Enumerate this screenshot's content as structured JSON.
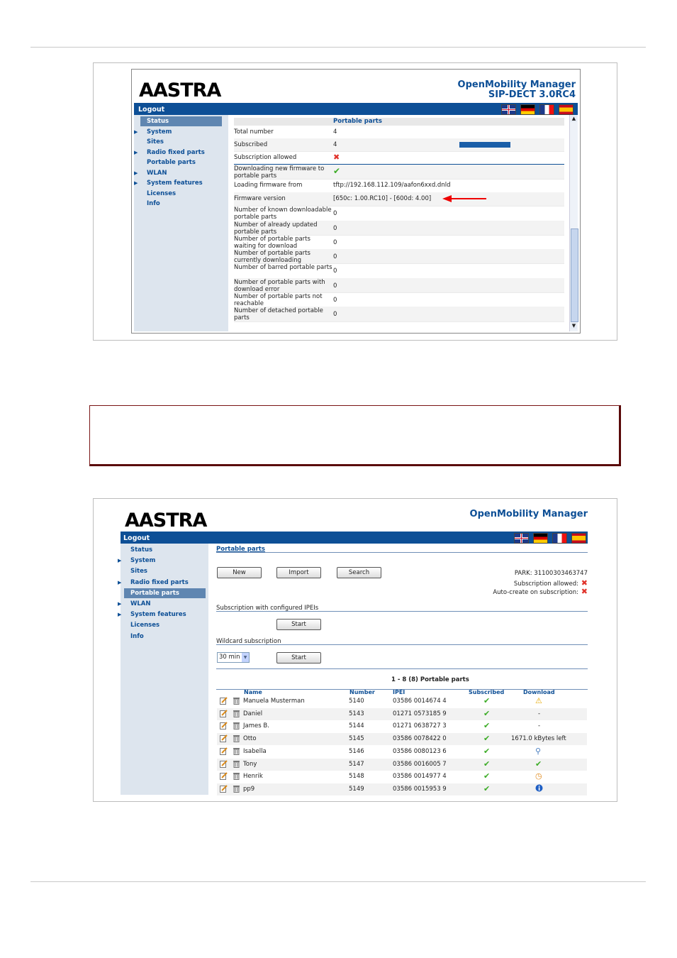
{
  "screen1": {
    "logo": "AASTRA",
    "app_title": "OpenMobility Manager",
    "app_version": "SIP-DECT 3.0RC4",
    "logout": "Logout",
    "nav": [
      {
        "label": "Status",
        "arrow": false,
        "selected": true
      },
      {
        "label": "System",
        "arrow": true,
        "selected": false
      },
      {
        "label": "Sites",
        "arrow": false,
        "selected": false
      },
      {
        "label": "Radio fixed parts",
        "arrow": true,
        "selected": false
      },
      {
        "label": "Portable parts",
        "arrow": false,
        "selected": false
      },
      {
        "label": "WLAN",
        "arrow": true,
        "selected": false
      },
      {
        "label": "System features",
        "arrow": true,
        "selected": false
      },
      {
        "label": "Licenses",
        "arrow": false,
        "selected": false
      },
      {
        "label": "Info",
        "arrow": false,
        "selected": false
      }
    ],
    "section_title": "Portable parts",
    "rows": [
      {
        "label": "Total number",
        "value": "4"
      },
      {
        "label": "Subscribed",
        "value": "4"
      },
      {
        "label": "Subscription allowed",
        "value": "✖"
      },
      {
        "label": "Downloading new firmware to portable parts",
        "value": "✔"
      },
      {
        "label": "Loading firmware from",
        "value": "tftp://192.168.112.109/aafon6xxd.dnld"
      },
      {
        "label": "Firmware version",
        "value": "[650c: 1.00.RC10] - [600d: 4.00]"
      },
      {
        "label": "Number of known downloadable portable parts",
        "value": "0"
      },
      {
        "label": "Number of already updated portable parts",
        "value": "0"
      },
      {
        "label": "Number of portable parts waiting for download",
        "value": "0"
      },
      {
        "label": "Number of portable parts currently downloading",
        "value": "0"
      },
      {
        "label": "Number of barred portable parts",
        "value": "0"
      },
      {
        "label": "Number of portable parts with download error",
        "value": "0"
      },
      {
        "label": "Number of portable parts not reachable",
        "value": "0"
      },
      {
        "label": "Number of detached portable parts",
        "value": "0"
      }
    ],
    "subscribed_fraction": 1.0
  },
  "screen2": {
    "logo": "AASTRA",
    "app_title": "OpenMobility Manager",
    "logout": "Logout",
    "nav": [
      {
        "label": "Status",
        "arrow": false,
        "selected": false
      },
      {
        "label": "System",
        "arrow": true,
        "selected": false
      },
      {
        "label": "Sites",
        "arrow": false,
        "selected": false
      },
      {
        "label": "Radio fixed parts",
        "arrow": true,
        "selected": false
      },
      {
        "label": "Portable parts",
        "arrow": false,
        "selected": true
      },
      {
        "label": "WLAN",
        "arrow": true,
        "selected": false
      },
      {
        "label": "System features",
        "arrow": true,
        "selected": false
      },
      {
        "label": "Licenses",
        "arrow": false,
        "selected": false
      },
      {
        "label": "Info",
        "arrow": false,
        "selected": false
      }
    ],
    "page_title": "Portable parts",
    "buttons": {
      "new": "New",
      "import": "Import",
      "search": "Search",
      "start": "Start"
    },
    "park": "PARK: 31100303463747",
    "subscription_allowed": "Subscription allowed:",
    "auto_create": "Auto-create on subscription:",
    "subscription_configured": "Subscription with configured IPEIs",
    "wildcard": "Wildcard subscription",
    "wildcard_select": "30 min",
    "list_title": "1 - 8 (8) Portable parts",
    "columns": {
      "name": "Name",
      "number": "Number",
      "ipei": "IPEI",
      "subscribed": "Subscribed",
      "download": "Download"
    },
    "rows": [
      {
        "name": "Manuela Musterman",
        "number": "5140",
        "ipei": "03586 0014674 4",
        "download": "warning-icon",
        "download_text": ""
      },
      {
        "name": "Daniel",
        "number": "5143",
        "ipei": "01271 0573185 9",
        "download": "text",
        "download_text": "-"
      },
      {
        "name": "James B.",
        "number": "5144",
        "ipei": "01271 0638727 3",
        "download": "text",
        "download_text": "-"
      },
      {
        "name": "Otto",
        "number": "5145",
        "ipei": "03586 0078422 0",
        "download": "text",
        "download_text": "1671.0 kBytes left"
      },
      {
        "name": "Isabella",
        "number": "5146",
        "ipei": "03586 0080123 6",
        "download": "magnifier-icon",
        "download_text": ""
      },
      {
        "name": "Tony",
        "number": "5147",
        "ipei": "03586 0016005 7",
        "download": "check-icon",
        "download_text": ""
      },
      {
        "name": "Henrik",
        "number": "5148",
        "ipei": "03586 0014977 4",
        "download": "clock-icon",
        "download_text": ""
      },
      {
        "name": "pp9",
        "number": "5149",
        "ipei": "03586 0015953 9",
        "download": "info-icon",
        "download_text": ""
      }
    ]
  }
}
